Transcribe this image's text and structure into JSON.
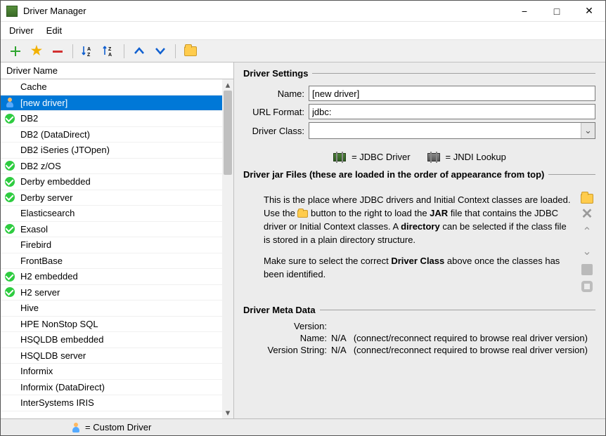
{
  "window": {
    "title": "Driver Manager"
  },
  "menu": {
    "driver": "Driver",
    "edit": "Edit"
  },
  "toolbar": {
    "add": "+",
    "star": "★",
    "remove": "—",
    "sortAZ": "A\nZ",
    "sortZA": "Z\nA",
    "up": "⌃",
    "down": "⌄",
    "folder": ""
  },
  "list": {
    "header": "Driver Name",
    "items": [
      {
        "label": "Cache",
        "status": "none",
        "selected": false,
        "icon": "none"
      },
      {
        "label": "[new driver]",
        "status": "none",
        "selected": true,
        "icon": "user"
      },
      {
        "label": "DB2",
        "status": "ok",
        "selected": false,
        "icon": "check"
      },
      {
        "label": "DB2 (DataDirect)",
        "status": "none",
        "selected": false,
        "icon": "none"
      },
      {
        "label": "DB2 iSeries (JTOpen)",
        "status": "none",
        "selected": false,
        "icon": "none"
      },
      {
        "label": "DB2 z/OS",
        "status": "ok",
        "selected": false,
        "icon": "check"
      },
      {
        "label": "Derby embedded",
        "status": "ok",
        "selected": false,
        "icon": "check"
      },
      {
        "label": "Derby server",
        "status": "ok",
        "selected": false,
        "icon": "check"
      },
      {
        "label": "Elasticsearch",
        "status": "none",
        "selected": false,
        "icon": "none"
      },
      {
        "label": "Exasol",
        "status": "ok",
        "selected": false,
        "icon": "check"
      },
      {
        "label": "Firebird",
        "status": "none",
        "selected": false,
        "icon": "none"
      },
      {
        "label": "FrontBase",
        "status": "none",
        "selected": false,
        "icon": "none"
      },
      {
        "label": "H2 embedded",
        "status": "ok",
        "selected": false,
        "icon": "check"
      },
      {
        "label": "H2 server",
        "status": "ok",
        "selected": false,
        "icon": "check"
      },
      {
        "label": "Hive",
        "status": "none",
        "selected": false,
        "icon": "none"
      },
      {
        "label": "HPE NonStop SQL",
        "status": "none",
        "selected": false,
        "icon": "none"
      },
      {
        "label": "HSQLDB embedded",
        "status": "none",
        "selected": false,
        "icon": "none"
      },
      {
        "label": "HSQLDB server",
        "status": "none",
        "selected": false,
        "icon": "none"
      },
      {
        "label": "Informix",
        "status": "none",
        "selected": false,
        "icon": "none"
      },
      {
        "label": "Informix (DataDirect)",
        "status": "none",
        "selected": false,
        "icon": "none"
      },
      {
        "label": "InterSystems IRIS",
        "status": "none",
        "selected": false,
        "icon": "none"
      }
    ]
  },
  "settings": {
    "legend": "Driver Settings",
    "nameLabel": "Name:",
    "nameValue": "[new driver]",
    "urlLabel": "URL Format:",
    "urlValue": "jdbc:",
    "classLabel": "Driver Class:",
    "classValue": ""
  },
  "iconLegend": {
    "jdbc": "= JDBC Driver",
    "jndi": "= JNDI Lookup"
  },
  "jar": {
    "legend": "Driver jar Files (these are loaded in the order of appearance from top)",
    "p1a": "This is the place where JDBC drivers and Initial Context classes are loaded. Use the ",
    "p1b": " button to the right to load the ",
    "p1jar": "JAR",
    "p1c": " file that contains the JDBC driver or Initial Context classes. A ",
    "p1dir": "directory",
    "p1d": " can be selected if the class file is stored in a plain directory structure.",
    "p2a": "Make sure to select the correct ",
    "p2dc": "Driver Class",
    "p2b": " above once the classes has been identified."
  },
  "meta": {
    "legend": "Driver Meta Data",
    "versionLabel": "Version:",
    "versionValue": "",
    "nameLabel": "Name:",
    "nameValue": "N/A",
    "nameHint": "(connect/reconnect required to browse real driver version)",
    "vstrLabel": "Version String:",
    "vstrValue": "N/A",
    "vstrHint": "(connect/reconnect required to browse real driver version)"
  },
  "footer": {
    "text": "= Custom Driver"
  }
}
